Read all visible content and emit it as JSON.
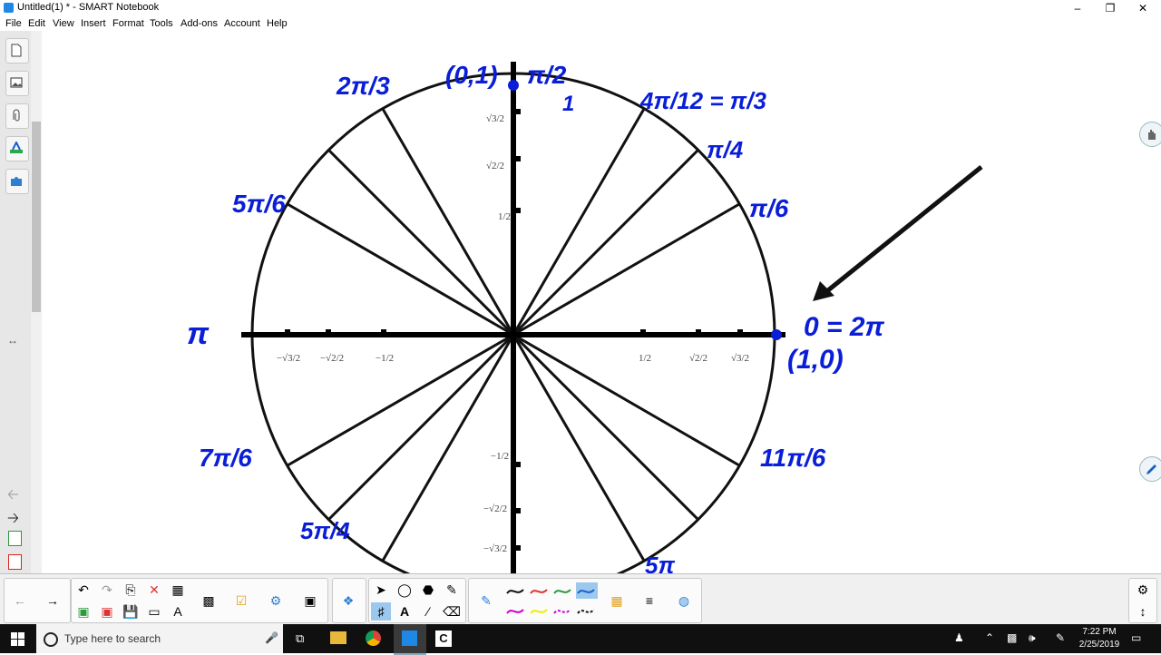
{
  "window": {
    "title": "Untitled(1) * - SMART Notebook",
    "controls": [
      "minimize",
      "restore",
      "close"
    ]
  },
  "menu": [
    "File",
    "Edit",
    "View",
    "Insert",
    "Format",
    "Tools",
    "Add-ons",
    "Account",
    "Help"
  ],
  "sidebar": {
    "items": [
      {
        "name": "page-sorter",
        "icon": "page-icon"
      },
      {
        "name": "gallery",
        "icon": "image-icon"
      },
      {
        "name": "attachments",
        "icon": "paperclip-icon"
      },
      {
        "name": "properties",
        "icon": "properties-icon"
      },
      {
        "name": "add-ons",
        "icon": "puzzle-icon"
      }
    ]
  },
  "unit_circle": {
    "ticks": {
      "y_pos": [
        "√3/2",
        "√2/2",
        "1/2"
      ],
      "y_neg": [
        "−1/2",
        "−√2/2",
        "−√3/2"
      ],
      "x_pos": [
        "1/2",
        "√2/2",
        "√3/2"
      ],
      "x_neg": [
        "−√3/2",
        "−√2/2",
        "−1/2"
      ]
    },
    "handwriting": {
      "top_point": "(0,1)",
      "top_angle": "π/2",
      "top_mark": "1",
      "q1_a": "4π/12 = π/3",
      "q1_b": "π/4",
      "q1_c": "π/6",
      "q2_a": "2π/3",
      "q2_b": "5π/6",
      "left": "π",
      "right_angle": "0 = 2π",
      "right_point": "(1,0)",
      "q3_a": "7π/6",
      "q3_b": "5π/4",
      "q4_a": "11π/6",
      "bottom_right_partial": "5π"
    }
  },
  "toolbar": {
    "groups": [
      "navigation",
      "undo-redo",
      "insert",
      "tools",
      "pens",
      "settings"
    ]
  },
  "taskbar": {
    "search_placeholder": "Type here to search",
    "time": "7:22 PM",
    "date": "2/25/2019"
  },
  "colors": {
    "ink_blue": "#0a1ed8",
    "arrow": "#111111",
    "taskbar": "#101010"
  }
}
